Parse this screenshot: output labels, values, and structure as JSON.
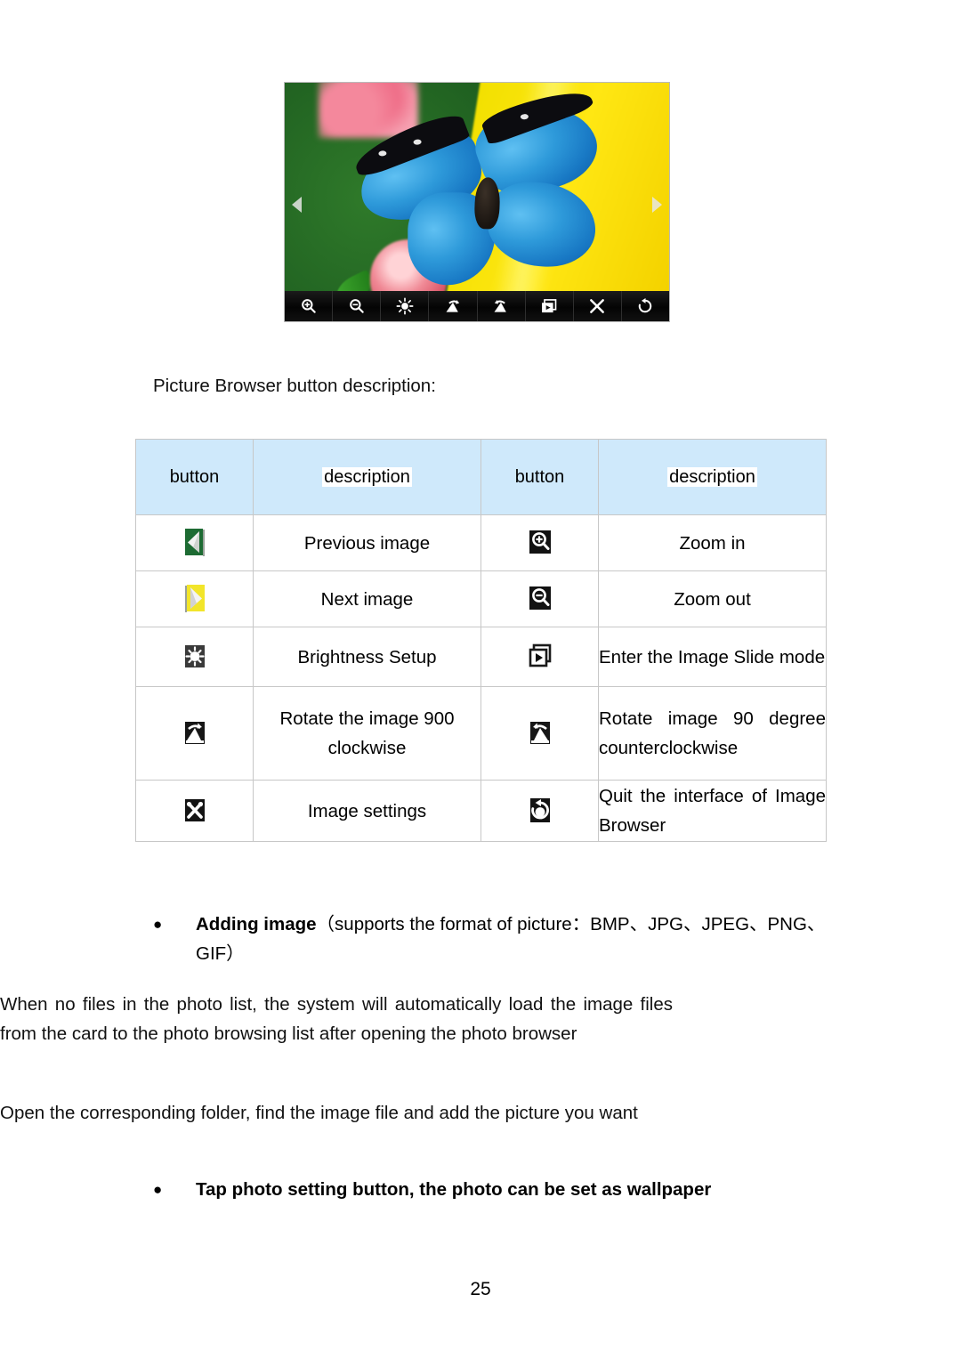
{
  "figure": {
    "name": "picture-browser-screenshot",
    "nav_prev_icon": "triangle-left-icon",
    "nav_next_icon": "triangle-right-icon",
    "toolbar_buttons": [
      {
        "icon": "zoom-in-icon",
        "label": "Zoom in"
      },
      {
        "icon": "zoom-out-icon",
        "label": "Zoom out"
      },
      {
        "icon": "brightness-icon",
        "label": "Brightness Setup"
      },
      {
        "icon": "rotate-cw-icon",
        "label": "Rotate the image 900 clockwise"
      },
      {
        "icon": "rotate-ccw-icon",
        "label": "Rotate image 90 degree counterclockwise"
      },
      {
        "icon": "slideshow-icon",
        "label": "Enter the Image Slide mode"
      },
      {
        "icon": "settings-icon",
        "label": "Image settings"
      },
      {
        "icon": "quit-icon",
        "label": "Quit the interface of Image Browser"
      }
    ]
  },
  "caption": "Picture Browser button description:",
  "table": {
    "headers": [
      "button",
      "description",
      "button",
      "description"
    ],
    "rows": [
      {
        "left_icon": "previous-image-icon",
        "left_desc": "Previous image",
        "right_icon": "zoom-in-icon",
        "right_desc": "Zoom in"
      },
      {
        "left_icon": "next-image-icon",
        "left_desc": "Next image",
        "right_icon": "zoom-out-icon",
        "right_desc": "Zoom out"
      },
      {
        "left_icon": "brightness-setup-icon",
        "left_desc": "Brightness Setup",
        "right_icon": "image-slide-icon",
        "right_desc": "Enter the Image Slide mode"
      },
      {
        "left_icon": "rotate-clockwise-icon",
        "left_desc": "Rotate the image 900 clockwise",
        "right_icon": "rotate-counterclockwise-icon",
        "right_desc": "Rotate image 90 degree counterclockwise"
      },
      {
        "left_icon": "image-settings-icon",
        "left_desc": "Image settings",
        "right_icon": "quit-browser-icon",
        "right_desc": "Quit the interface of Image Browser"
      }
    ]
  },
  "bullets": {
    "bullet_glyph": "●",
    "item1_bold": "Adding image",
    "item1_rest": "（supports the format of picture：BMP、JPG、JPEG、PNG、GIF）",
    "item2": "Tap photo setting button, the photo can be set as wallpaper"
  },
  "paragraphs": {
    "p1": "When no files in the photo list, the system will automatically load the image files from the card to the photo browsing list after opening the photo browser",
    "p2": "Open the corresponding folder, find the image file and add the picture you want"
  },
  "page_number": "25",
  "colors": {
    "table_header_bg": "#cfe9fb",
    "table_border": "#c7c7c7",
    "prev_icon_bg": "#1d6b33",
    "next_icon_bg": "#f2e52a",
    "toolbar_bg": "#080808"
  }
}
